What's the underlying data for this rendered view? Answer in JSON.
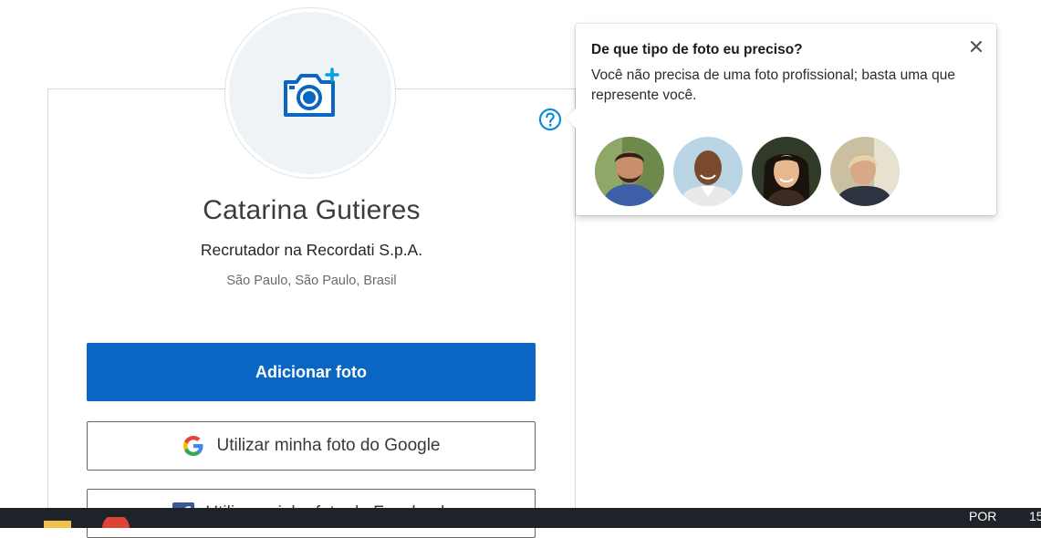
{
  "profile": {
    "name": "Catarina Gutieres",
    "headline": "Recrutador na Recordati S.p.A.",
    "location": "São Paulo, São Paulo, Brasil"
  },
  "actions": {
    "add_photo": "Adicionar foto",
    "google_photo": "Utilizar minha foto do Google",
    "facebook_photo": "Utilizar minha foto do Facebook"
  },
  "popover": {
    "title": "De que tipo de foto eu preciso?",
    "body": "Você não precisa de uma foto profissional; basta uma que represente você."
  },
  "taskbar": {
    "language": "POR",
    "time": "15"
  },
  "colors": {
    "primary": "#0a66c2",
    "help": "#0a8ed6",
    "camera": "#0a66c2",
    "camera_plus": "#00a0dc",
    "taskbar": "#1e2329"
  },
  "icons": [
    "camera-add-icon",
    "help-icon",
    "close-icon",
    "google-icon",
    "facebook-icon",
    "folder-icon",
    "chrome-icon"
  ]
}
